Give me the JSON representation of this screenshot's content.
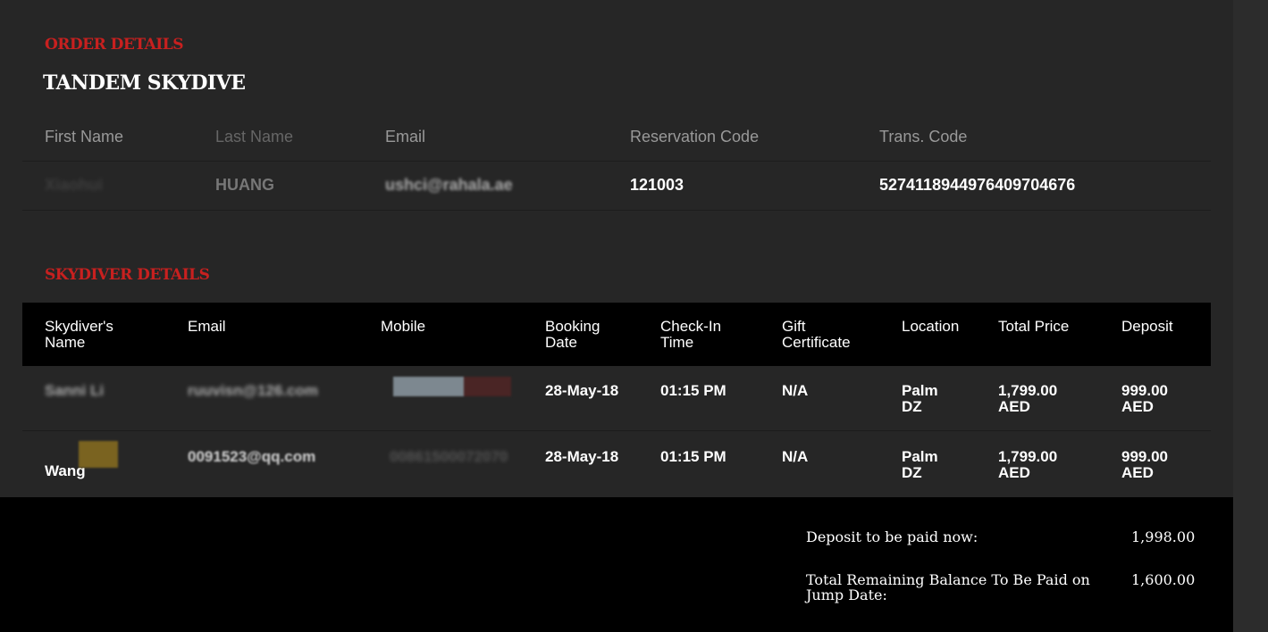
{
  "order_section": {
    "heading": "ORDER DETAILS",
    "product": "TANDEM SKYDIVE",
    "columns": [
      "First Name",
      "Last Name",
      "Email",
      "Reservation Code",
      "Trans. Code"
    ],
    "values": [
      "Xiaohui",
      "HUANG",
      "ushci@rahala.ae",
      "121003",
      "52741189449764097046​76"
    ]
  },
  "skydiver_section": {
    "heading": "SKYDIVER DETAILS",
    "columns": [
      "Skydiver's Name",
      "Email",
      "Mobile",
      "Booking Date",
      "Check-In Time",
      "Gift Certificate",
      "Location",
      "Total Price",
      "Deposit"
    ],
    "rows": [
      {
        "name": "Sanni Li",
        "email": "ruuvisn@126.com",
        "mobile": "0501234567",
        "booking_date": "28-May-18",
        "checkin": "01:15 PM",
        "gift": "N/A",
        "location": "Palm DZ",
        "total": "1,799.00 AED",
        "deposit": "999.00 AED"
      },
      {
        "name": "Wang",
        "email": "0091523@qq.com",
        "mobile": "00861500072070",
        "booking_date": "28-May-18",
        "checkin": "01:15 PM",
        "gift": "N/A",
        "location": "Palm DZ",
        "total": "1,799.00 AED",
        "deposit": "999.00 AED"
      }
    ]
  },
  "summary": {
    "deposit_label": "Deposit to be paid now:",
    "deposit_value": "1,998.00",
    "balance_label": "Total Remaining Balance To Be Paid on Jump Date:",
    "balance_value": "1,600.00"
  }
}
